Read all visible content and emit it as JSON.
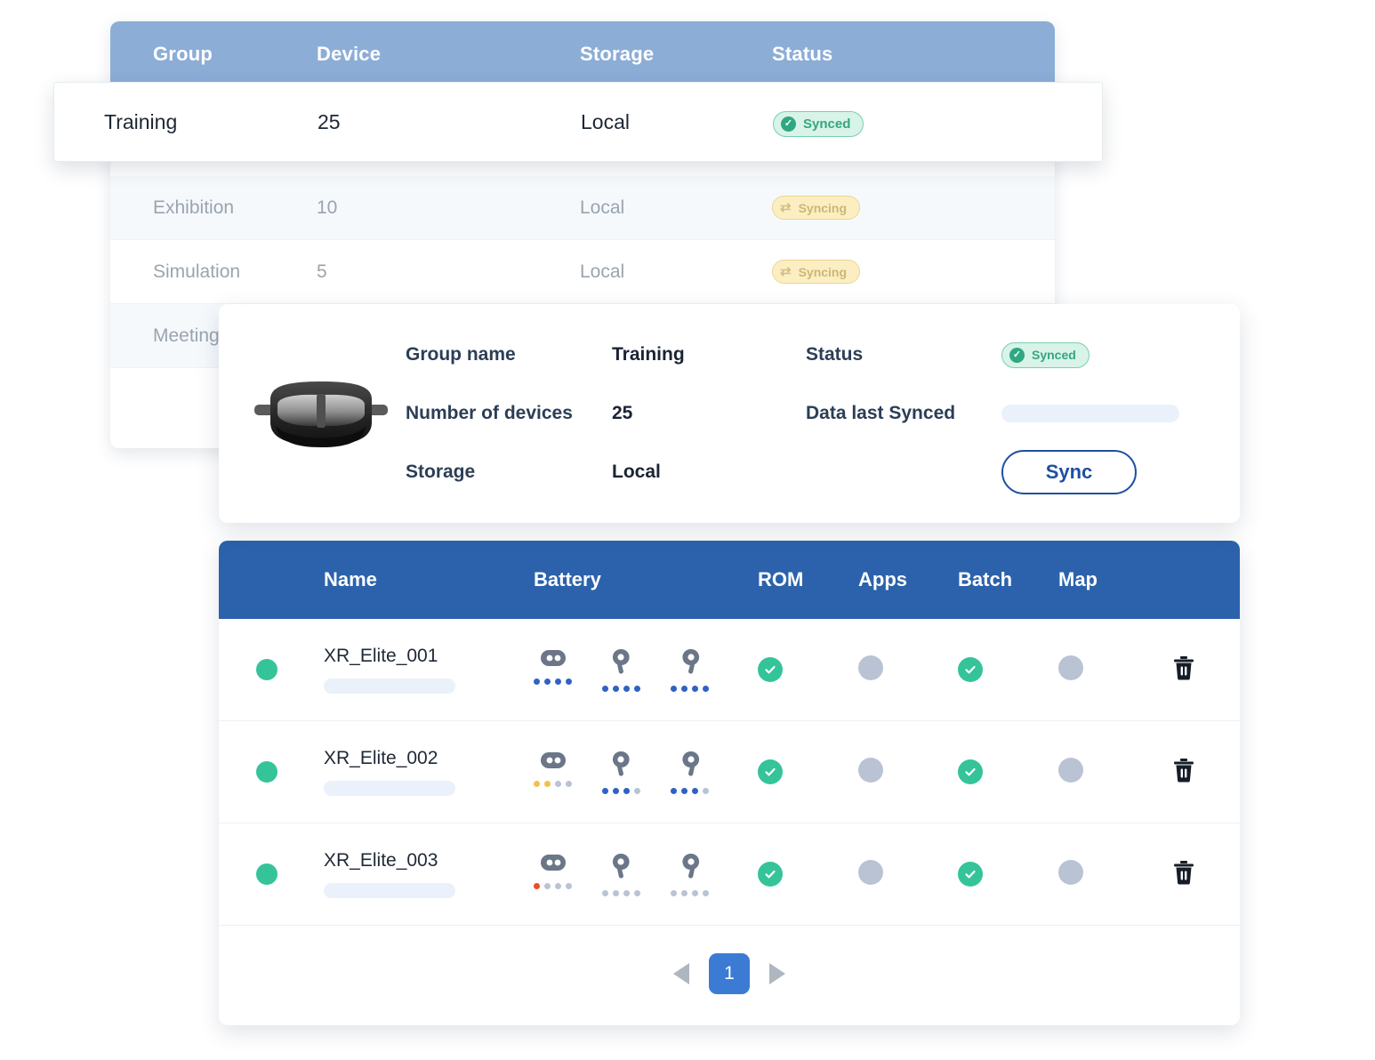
{
  "group_table": {
    "columns": [
      "Group",
      "Device",
      "Storage",
      "Status"
    ],
    "rows": [
      {
        "group": "Exhibition",
        "device": "10",
        "storage": "Local",
        "status": "Syncing",
        "status_type": "syncing"
      },
      {
        "group": "Simulation",
        "device": "5",
        "storage": "Local",
        "status": "Syncing",
        "status_type": "syncing"
      },
      {
        "group": "Meeting",
        "device": "",
        "storage": "",
        "status": "",
        "status_type": "none"
      }
    ]
  },
  "selected_row": {
    "group": "Training",
    "device": "25",
    "storage": "Local",
    "status": "Synced",
    "status_type": "synced"
  },
  "detail_card": {
    "device_icon": "vr-headset-icon",
    "fields": [
      {
        "label": "Group name",
        "value": "Training"
      },
      {
        "label": "Number of devices",
        "value": "25"
      },
      {
        "label": "Storage",
        "value": "Local"
      }
    ],
    "status_label": "Status",
    "status_value": "Synced",
    "last_synced_label": "Data last Synced",
    "last_synced_value": "",
    "sync_button": "Sync"
  },
  "device_table": {
    "columns": [
      "",
      "Name",
      "Battery",
      "ROM",
      "Apps",
      "Batch",
      "Map",
      ""
    ],
    "rows": [
      {
        "online": true,
        "name": "XR_Elite_001",
        "battery": [
          {
            "icon": "headset-icon",
            "level": 4,
            "color": "#2f62c4"
          },
          {
            "icon": "controller-left-icon",
            "level": 4,
            "color": "#2f62c4"
          },
          {
            "icon": "controller-right-icon",
            "level": 4,
            "color": "#2f62c4"
          }
        ],
        "rom": true,
        "apps": false,
        "batch": true,
        "map": false,
        "delete_icon": "trash-icon"
      },
      {
        "online": true,
        "name": "XR_Elite_002",
        "battery": [
          {
            "icon": "headset-icon",
            "level": 2,
            "color": "#f2c14e"
          },
          {
            "icon": "controller-left-icon",
            "level": 3,
            "color": "#2f62c4"
          },
          {
            "icon": "controller-right-icon",
            "level": 3,
            "color": "#2f62c4"
          }
        ],
        "rom": true,
        "apps": false,
        "batch": true,
        "map": false,
        "delete_icon": "trash-icon"
      },
      {
        "online": true,
        "name": "XR_Elite_003",
        "battery": [
          {
            "icon": "headset-icon",
            "level": 1,
            "color": "#ef4b2b"
          },
          {
            "icon": "controller-left-icon",
            "level": 0,
            "color": "#b9c3d4"
          },
          {
            "icon": "controller-right-icon",
            "level": 0,
            "color": "#b9c3d4"
          }
        ],
        "rom": true,
        "apps": false,
        "batch": true,
        "map": false,
        "delete_icon": "trash-icon"
      }
    ]
  },
  "pagination": {
    "prev_icon": "triangle-left-icon",
    "next_icon": "triangle-right-icon",
    "current_page": "1"
  },
  "colors": {
    "header_light_blue": "#8cadd6",
    "header_dark_blue": "#2b62ab",
    "accent_green": "#35c49a",
    "accent_yellow": "#f2c14e",
    "accent_red": "#ef4b2b",
    "muted_gray": "#b9c3d4",
    "link_blue": "#1f4fa3"
  }
}
